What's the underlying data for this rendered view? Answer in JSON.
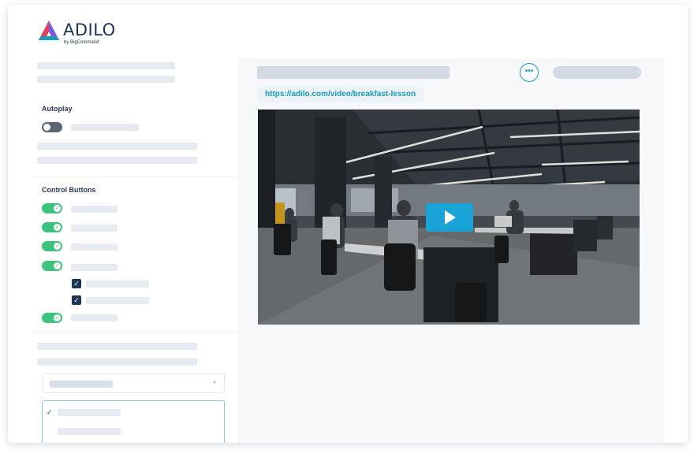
{
  "brand": {
    "name": "ADILO",
    "tagline": "by BigCommand",
    "colors": [
      "#e4405f",
      "#7b5cd6",
      "#1a9cb8"
    ]
  },
  "sidebar": {
    "autoplay": {
      "label": "Autoplay",
      "enabled": false
    },
    "control_buttons": {
      "label": "Control Buttons",
      "toggles": [
        true,
        true,
        true,
        true
      ],
      "checkboxes": [
        true,
        true
      ],
      "last_toggle": true
    },
    "dropdown": {
      "selected_icon": "check-icon",
      "chevron_icon": "chevron-down-icon"
    }
  },
  "main": {
    "url": "https://adilo.com/video/breakfast-lesson",
    "more_icon": "more-horizontal-icon",
    "video": {
      "play_icon": "play-icon",
      "accent": "#1aa3d6"
    }
  },
  "colors": {
    "toggle_on": "#3ec37f",
    "toggle_off": "#5a6676",
    "checkbox": "#1f3556",
    "accent": "#1a9cb8"
  }
}
